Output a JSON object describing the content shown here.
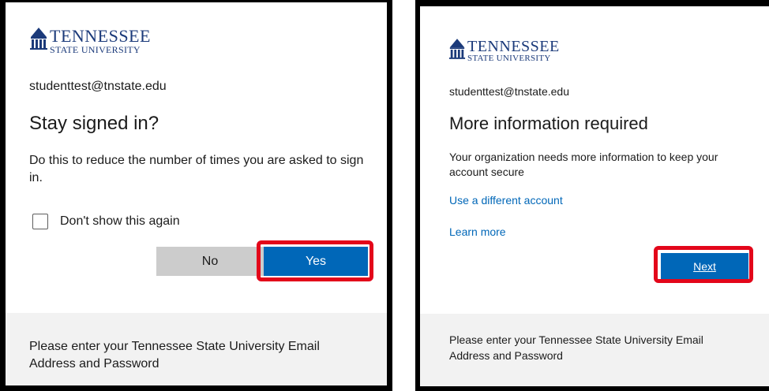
{
  "left_panel": {
    "logo": {
      "line1": "TENNESSEE",
      "line2": "STATE UNIVERSITY"
    },
    "email": "studenttest@tnstate.edu",
    "title": "Stay signed in?",
    "description": "Do this to reduce the number of times you are asked to sign in.",
    "checkbox_label": "Don't show this again",
    "no_label": "No",
    "yes_label": "Yes",
    "footer": "Please enter your Tennessee State University Email Address and Password"
  },
  "right_panel": {
    "logo": {
      "line1": "TENNESSEE",
      "line2": "STATE UNIVERSITY"
    },
    "email": "studenttest@tnstate.edu",
    "title": "More information required",
    "description": "Your organization needs more information to keep your account secure",
    "different_account_link": "Use a different account",
    "learn_more_link": "Learn more",
    "next_label": "Next",
    "footer": "Please enter your Tennessee State University Email Address and Password"
  },
  "colors": {
    "accent": "#0067b8",
    "highlight": "#e3061a",
    "logo": "#1b3a7a"
  }
}
